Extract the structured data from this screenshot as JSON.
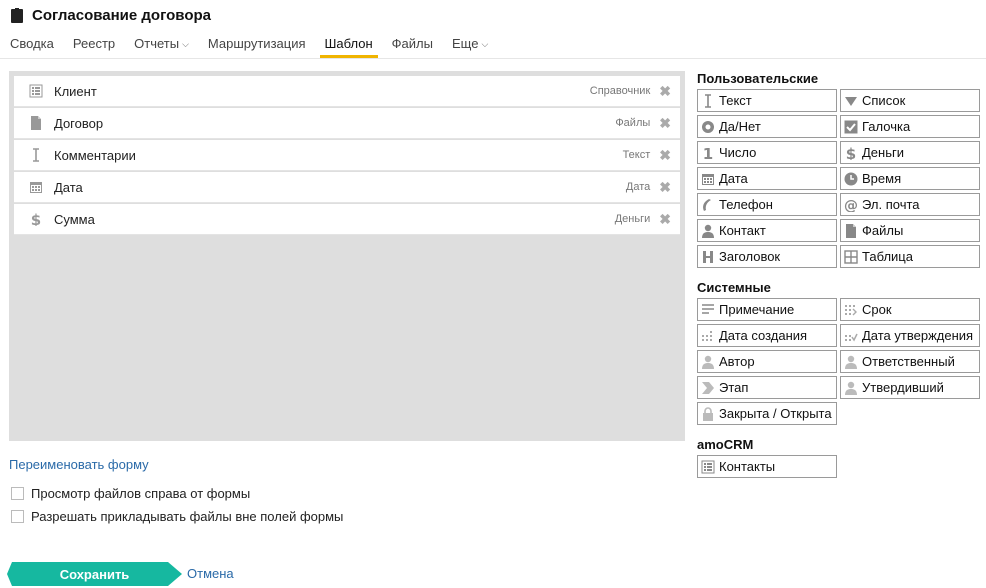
{
  "header": {
    "title": "Согласование договора",
    "tabs": [
      {
        "label": "Сводка",
        "chevron": ""
      },
      {
        "label": "Реестр",
        "chevron": ""
      },
      {
        "label": "Отчеты",
        "chevron": "⌵"
      },
      {
        "label": "Маршрутизация",
        "chevron": ""
      },
      {
        "label": "Шаблон",
        "chevron": ""
      },
      {
        "label": "Файлы",
        "chevron": ""
      },
      {
        "label": "Еще",
        "chevron": "⌵"
      }
    ],
    "active_tab": "Шаблон"
  },
  "form": {
    "fields": [
      {
        "name": "Клиент",
        "type": "Справочник",
        "icon": "list-icon"
      },
      {
        "name": "Договор",
        "type": "Файлы",
        "icon": "file-icon"
      },
      {
        "name": "Комментарии",
        "type": "Текст",
        "icon": "text-cursor-icon"
      },
      {
        "name": "Дата",
        "type": "Дата",
        "icon": "calendar-icon"
      },
      {
        "name": "Сумма",
        "type": "Деньги",
        "icon": "dollar-icon"
      }
    ],
    "delete_glyph": "✖",
    "rename_link": "Переименовать форму",
    "options": [
      {
        "label": "Просмотр файлов справа от формы",
        "checked": false
      },
      {
        "label": "Разрешать прикладывать файлы вне полей формы",
        "checked": false
      }
    ],
    "save_label": "Сохранить",
    "cancel_label": "Отмена"
  },
  "palette": {
    "user_title": "Пользовательские",
    "user_items": [
      {
        "label": "Текст",
        "icon": "text-cursor-icon"
      },
      {
        "label": "Список",
        "icon": "triangle-down-icon"
      },
      {
        "label": "Да/Нет",
        "icon": "radio-icon"
      },
      {
        "label": "Галочка",
        "icon": "checkbox-icon"
      },
      {
        "label": "Число",
        "icon": "number-one-icon"
      },
      {
        "label": "Деньги",
        "icon": "dollar-icon"
      },
      {
        "label": "Дата",
        "icon": "calendar-icon"
      },
      {
        "label": "Время",
        "icon": "clock-icon"
      },
      {
        "label": "Телефон",
        "icon": "phone-icon"
      },
      {
        "label": "Эл. почта",
        "icon": "at-icon"
      },
      {
        "label": "Контакт",
        "icon": "person-icon"
      },
      {
        "label": "Файлы",
        "icon": "file-icon"
      },
      {
        "label": "Заголовок",
        "icon": "heading-icon"
      },
      {
        "label": "Таблица",
        "icon": "table-icon"
      }
    ],
    "system_title": "Системные",
    "system_items": [
      {
        "label": "Примечание",
        "icon": "note-lines-icon"
      },
      {
        "label": "Срок",
        "icon": "deadline-calendar-icon"
      },
      {
        "label": "Дата создания",
        "icon": "date-created-icon"
      },
      {
        "label": "Дата утверждения",
        "icon": "date-approved-icon"
      },
      {
        "label": "Автор",
        "icon": "author-icon"
      },
      {
        "label": "Ответственный",
        "icon": "responsible-icon"
      },
      {
        "label": "Этап",
        "icon": "stage-arrow-icon"
      },
      {
        "label": "Утвердивший",
        "icon": "approver-icon"
      },
      {
        "label": "Закрыта / Открыта",
        "icon": "lock-icon"
      }
    ],
    "amo_title": "amoCRM",
    "amo_items": [
      {
        "label": "Контакты",
        "icon": "contacts-list-icon"
      }
    ]
  },
  "colors": {
    "accent_tab": "#f0b400",
    "save_button": "#16b8a0",
    "link": "#2a6aa8",
    "form_bg": "#dedede"
  }
}
